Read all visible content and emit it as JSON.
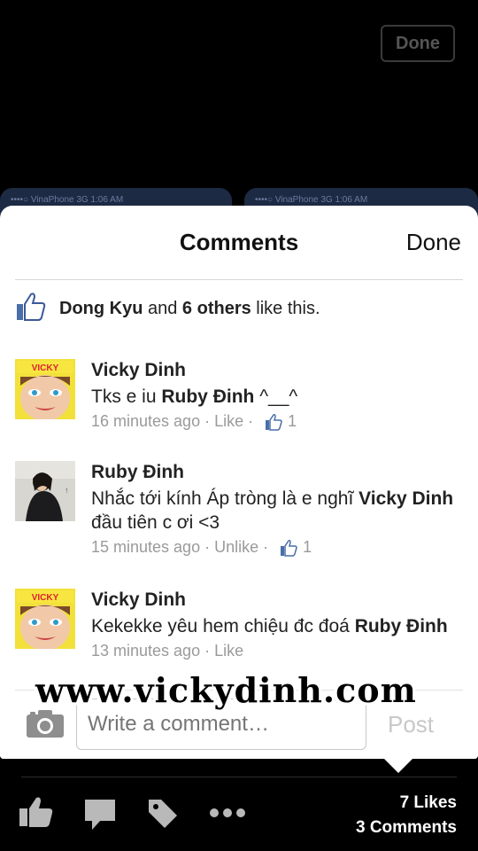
{
  "top_bar": {
    "done_label": "Done"
  },
  "background_tabs": [
    {
      "status": "••••○ VinaPhone  3G  1:06 AM"
    },
    {
      "status": "••••○ VinaPhone  3G  1:06 AM"
    }
  ],
  "sheet": {
    "title": "Comments",
    "done_label": "Done",
    "likes": {
      "name": "Dong Kyu",
      "middle": " and ",
      "others": "6 others",
      "suffix": " like this."
    }
  },
  "comments": [
    {
      "author": "Vicky Dinh",
      "text": "Tks e iu ",
      "mention": "Ruby Đinh",
      "text_after": " ^__^",
      "time": "16 minutes ago",
      "action": "Like",
      "like_count": "1"
    },
    {
      "author": "Ruby Đinh",
      "text": "Nhắc tới kính Áp tròng là e nghĩ ",
      "mention": "Vicky Dinh",
      "text_after": " đầu tiên c ơi <3",
      "time": "15 minutes ago",
      "action": "Unlike",
      "like_count": "1"
    },
    {
      "author": "Vicky Dinh",
      "text": "Kekekke yêu hem chiệu đc đoá ",
      "mention": "Ruby Đinh",
      "text_after": "",
      "time": "13 minutes ago",
      "action": "Like"
    }
  ],
  "composer": {
    "placeholder": "Write a comment…",
    "post_label": "Post"
  },
  "watermark": "www.vickydinh.com",
  "footer": {
    "likes_count": "7 Likes",
    "comments_count": "3 Comments"
  },
  "icons": [
    "like-icon",
    "comment-icon",
    "tag-icon",
    "more-icon",
    "camera-icon",
    "thumb-like-icon"
  ],
  "colors": {
    "accent": "#3b5998",
    "meta_gray": "#9a9a9a",
    "background": "#000000"
  }
}
